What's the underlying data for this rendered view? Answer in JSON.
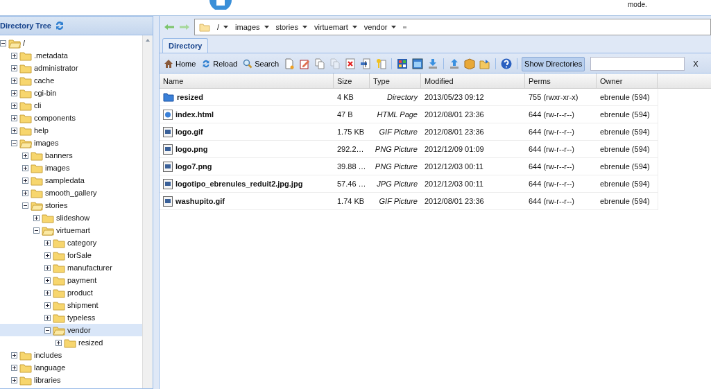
{
  "header": {
    "note": "mode."
  },
  "tree": {
    "title": "Directory Tree",
    "items": [
      {
        "label": "/",
        "expanded": true,
        "selected": false,
        "children": [
          {
            "label": ".metadata",
            "expanded": false,
            "selected": false
          },
          {
            "label": "administrator",
            "expanded": false,
            "selected": false
          },
          {
            "label": "cache",
            "expanded": false,
            "selected": false
          },
          {
            "label": "cgi-bin",
            "expanded": false,
            "selected": false
          },
          {
            "label": "cli",
            "expanded": false,
            "selected": false
          },
          {
            "label": "components",
            "expanded": false,
            "selected": false
          },
          {
            "label": "help",
            "expanded": false,
            "selected": false
          },
          {
            "label": "images",
            "expanded": true,
            "selected": false,
            "children": [
              {
                "label": "banners",
                "expanded": false,
                "selected": false
              },
              {
                "label": "images",
                "expanded": false,
                "selected": false
              },
              {
                "label": "sampledata",
                "expanded": false,
                "selected": false
              },
              {
                "label": "smooth_gallery",
                "expanded": false,
                "selected": false
              },
              {
                "label": "stories",
                "expanded": true,
                "selected": false,
                "children": [
                  {
                    "label": "slideshow",
                    "expanded": false,
                    "selected": false
                  },
                  {
                    "label": "virtuemart",
                    "expanded": true,
                    "selected": false,
                    "children": [
                      {
                        "label": "category",
                        "expanded": false,
                        "selected": false
                      },
                      {
                        "label": "forSale",
                        "expanded": false,
                        "selected": false
                      },
                      {
                        "label": "manufacturer",
                        "expanded": false,
                        "selected": false
                      },
                      {
                        "label": "payment",
                        "expanded": false,
                        "selected": false
                      },
                      {
                        "label": "product",
                        "expanded": false,
                        "selected": false
                      },
                      {
                        "label": "shipment",
                        "expanded": false,
                        "selected": false
                      },
                      {
                        "label": "typeless",
                        "expanded": false,
                        "selected": false
                      },
                      {
                        "label": "vendor",
                        "expanded": true,
                        "selected": true,
                        "children": [
                          {
                            "label": "resized",
                            "expanded": false,
                            "selected": false
                          }
                        ]
                      }
                    ]
                  }
                ]
              }
            ]
          },
          {
            "label": "includes",
            "expanded": false,
            "selected": false
          },
          {
            "label": "language",
            "expanded": false,
            "selected": false
          },
          {
            "label": "libraries",
            "expanded": false,
            "selected": false
          }
        ]
      }
    ]
  },
  "breadcrumb": [
    "/",
    "images",
    "stories",
    "virtuemart",
    "vendor"
  ],
  "tabs": [
    {
      "label": "Directory",
      "selected": true
    }
  ],
  "toolbar": {
    "buttons": [
      {
        "kind": "home",
        "label": "Home"
      },
      {
        "kind": "reload",
        "label": "Reload"
      },
      {
        "kind": "search",
        "label": "Search"
      }
    ],
    "tools": [
      {
        "kind": "new",
        "disabled": false
      },
      {
        "kind": "edit",
        "disabled": false
      },
      {
        "kind": "copy",
        "disabled": false
      },
      {
        "kind": "paste",
        "disabled": true
      },
      {
        "kind": "delete",
        "disabled": false
      },
      {
        "kind": "rename",
        "disabled": false
      },
      {
        "kind": "key",
        "disabled": false
      },
      {
        "kind": "sep"
      },
      {
        "kind": "grid",
        "disabled": false
      },
      {
        "kind": "window",
        "disabled": false
      },
      {
        "kind": "download",
        "disabled": false
      },
      {
        "kind": "sep"
      },
      {
        "kind": "upload",
        "disabled": false
      },
      {
        "kind": "archive",
        "disabled": false
      },
      {
        "kind": "extract",
        "disabled": false
      },
      {
        "kind": "sep"
      },
      {
        "kind": "help",
        "disabled": false
      }
    ],
    "toggle": {
      "label": "Show Directories",
      "pressed": true
    },
    "clear": "X"
  },
  "table": {
    "columns": [
      "Name",
      "Size",
      "Type",
      "Modified",
      "Perms",
      "Owner"
    ],
    "rows": [
      {
        "kind": "directory",
        "name": "resized",
        "size": "4 KB",
        "type": "Directory",
        "modified": "2013/05/23 09:12",
        "perms": "755 (rwxr-xr-x)",
        "owner": "ebrenule (594)"
      },
      {
        "kind": "html",
        "name": "index.html",
        "size": "47 B",
        "type": "HTML Page",
        "modified": "2012/08/01 23:36",
        "perms": "644 (rw-r--r--)",
        "owner": "ebrenule (594)"
      },
      {
        "kind": "image",
        "name": "logo.gif",
        "size": "1.75 KB",
        "type": "GIF Picture",
        "modified": "2012/08/01 23:36",
        "perms": "644 (rw-r--r--)",
        "owner": "ebrenule (594)"
      },
      {
        "kind": "image",
        "name": "logo.png",
        "size": "292.2…",
        "type": "PNG Picture",
        "modified": "2012/12/09 01:09",
        "perms": "644 (rw-r--r--)",
        "owner": "ebrenule (594)"
      },
      {
        "kind": "image",
        "name": "logo7.png",
        "size": "39.88 …",
        "type": "PNG Picture",
        "modified": "2012/12/03 00:11",
        "perms": "644 (rw-r--r--)",
        "owner": "ebrenule (594)"
      },
      {
        "kind": "image",
        "name": "logotipo_ebrenules_reduit2.jpg.jpg",
        "size": "57.46 …",
        "type": "JPG Picture",
        "modified": "2012/12/03 00:11",
        "perms": "644 (rw-r--r--)",
        "owner": "ebrenule (594)"
      },
      {
        "kind": "image",
        "name": "washupito.gif",
        "size": "1.74 KB",
        "type": "GIF Picture",
        "modified": "2012/08/01 23:36",
        "perms": "644 (rw-r--r--)",
        "owner": "ebrenule (594)"
      }
    ]
  }
}
